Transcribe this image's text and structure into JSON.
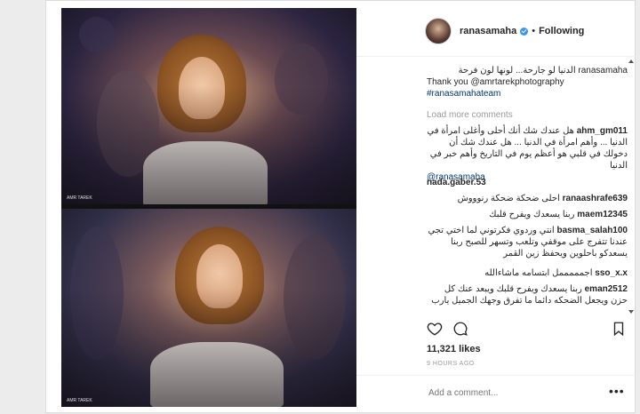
{
  "post": {
    "username": "ranasamaha",
    "follow_status": "Following",
    "separator": "•",
    "caption_lines": [
      "ranasamaha الدنيا لو جارحة... لونها لون فرحة",
      "Thank you @amrtarekphotography",
      "#ranasamahateam"
    ],
    "photo_stamp": "AMR TAREK",
    "load_more": "Load more comments",
    "likes": "11,321 likes",
    "time": "9 HOURS AGO",
    "add_comment_placeholder": "Add a comment...",
    "more_options": "•••"
  },
  "comments": [
    {
      "user": "ahm_gm011",
      "text": "هل عندك شك أنك أحلى وأغلى امرأة في الدنيا ... وأهم امرأة في الدنيا ... هل عندك شك أن دخولك في قلبي هو أعظم يوم في التاريخ وأهم خبر في الدنيا",
      "mention": "@ranasamaha"
    },
    {
      "user": "nada.gaber.53",
      "text": ""
    },
    {
      "user": "ranaashrafe639",
      "text": "احلى ضحكة ضحكة رنوووش"
    },
    {
      "user": "maem12345",
      "text": "ربنا يسعدك ويفرح قلبك"
    },
    {
      "user": "basma_salah100",
      "text": "انتي وردوي فكرتوني لما اختي تجي عندنا تتفرج على موقفي وتلعب وتسهر للصبح ربنا يسعدكو باحلوين ويحفظ زين القمر"
    },
    {
      "user": "sso_x.x",
      "text": "اجمممممل ابتسامه ماشاءالله"
    },
    {
      "user": "eman2512",
      "text": "ربنا يسعدك ويفرح قلبك ويبعد عنك كل حزن ويجعل الضحكه دائما ما تفرق وجهك الجميل يارب"
    }
  ],
  "icons": {
    "heart": "heart-icon",
    "comment": "comment-icon",
    "bookmark": "bookmark-icon",
    "verified": "verified-badge-icon"
  },
  "colors": {
    "link": "#003569",
    "verified": "#3897f0",
    "muted": "#999999"
  }
}
